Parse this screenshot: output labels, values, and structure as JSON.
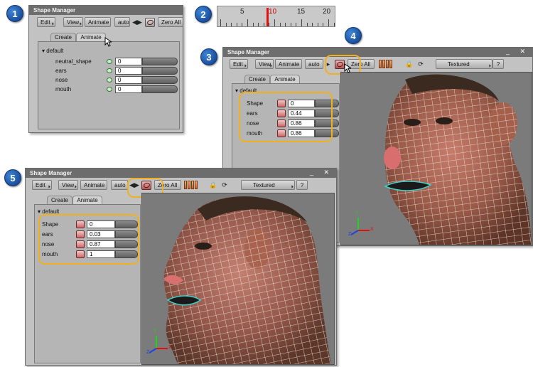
{
  "steps": [
    "1",
    "2",
    "3",
    "4",
    "5"
  ],
  "window_title": "Shape Manager",
  "toolbar": {
    "edit": "Edit",
    "view": "View",
    "animate": "Animate",
    "auto": "auto",
    "zero_all": "Zero All",
    "textured": "Textured",
    "help": "?"
  },
  "tabs": {
    "create": "Create",
    "animate": "Animate"
  },
  "timeline": {
    "labels": [
      "5",
      "10",
      "15",
      "20"
    ],
    "current": "10"
  },
  "panel1": {
    "group": "default",
    "rows": [
      {
        "label": "neutral_shape",
        "value": "0"
      },
      {
        "label": "ears",
        "value": "0"
      },
      {
        "label": "nose",
        "value": "0"
      },
      {
        "label": "mouth",
        "value": "0"
      }
    ]
  },
  "panel3": {
    "group": "default",
    "rows": [
      {
        "label": "Shape",
        "value": "0"
      },
      {
        "label": "ears",
        "value": "0.44"
      },
      {
        "label": "nose",
        "value": "0.86"
      },
      {
        "label": "mouth",
        "value": "0.86"
      }
    ]
  },
  "panel5": {
    "group": "default",
    "rows": [
      {
        "label": "Shape",
        "value": "0"
      },
      {
        "label": "ears",
        "value": "0.03"
      },
      {
        "label": "nose",
        "value": "0.87"
      },
      {
        "label": "mouth",
        "value": "1"
      }
    ]
  },
  "axes": {
    "x": "X",
    "y": "Y",
    "z": "Z"
  },
  "colors": {
    "highlight": "#f0b020",
    "playhead": "#e01010",
    "titlebar": "#6d6d6d"
  }
}
